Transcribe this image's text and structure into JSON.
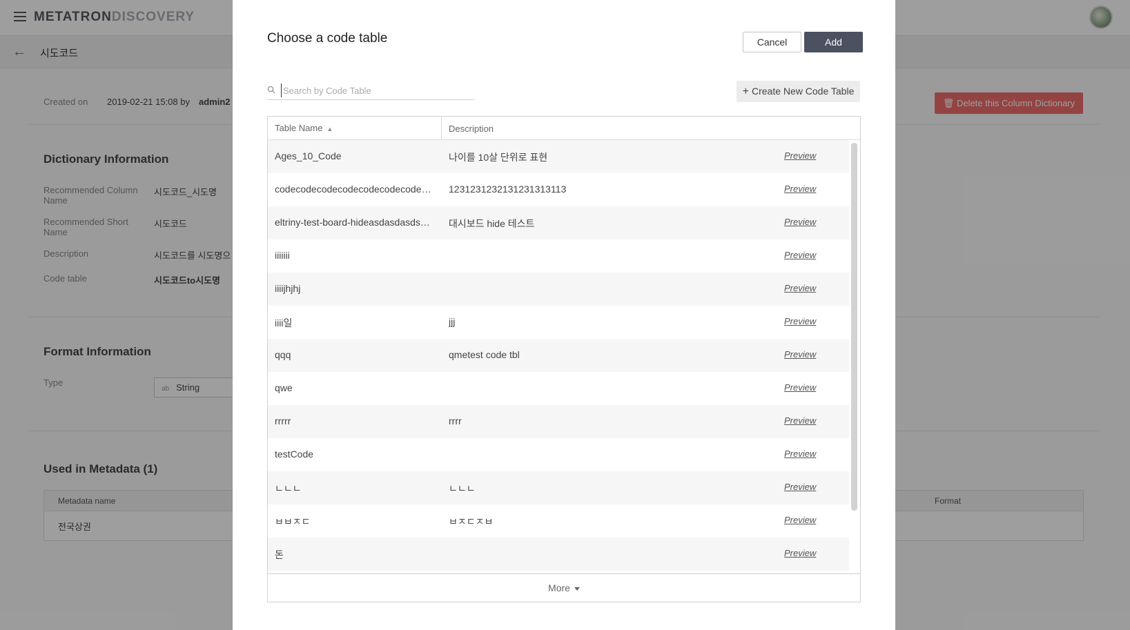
{
  "app": {
    "brand_primary": "METATRON",
    "brand_secondary": "DISCOVERY"
  },
  "page": {
    "title": "시도코드",
    "created_label": "Created on",
    "created_value": "2019-02-21 15:08 by",
    "created_user": "admin2",
    "delete_button": "Delete this Column Dictionary",
    "dictionary_section": "Dictionary Information",
    "rec_column_label": "Recommended Column Name",
    "rec_column_value": "시도코드_시도명",
    "rec_short_label": "Recommended Short Name",
    "rec_short_value": "시도코드",
    "description_label": "Description",
    "description_value": "시도코드를 시도명으",
    "code_table_label": "Code table",
    "code_table_value": "시도코드to시도명",
    "format_section": "Format Information",
    "type_label": "Type",
    "type_value": "String",
    "used_section": "Used in Metadata (1)",
    "meta_col_name": "Metadata name",
    "meta_col_format": "Format",
    "meta_row_name": "전국상권"
  },
  "modal": {
    "title": "Choose a code table",
    "cancel_label": "Cancel",
    "add_label": "Add",
    "search_placeholder": "Search by Code Table",
    "create_label": "Create New Code Table",
    "col_name": "Table Name",
    "col_desc": "Description",
    "preview_label": "Preview",
    "more_label": "More",
    "rows": [
      {
        "name": "Ages_10_Code",
        "desc": "나이를 10살 단위로 표현"
      },
      {
        "name": "codecodecodecodecodecodecodecodec…",
        "desc": "1231231232131231313113"
      },
      {
        "name": "eltriny-test-board-hideasdasdasds…",
        "desc": "대시보드 hide 테스트"
      },
      {
        "name": "iiiiiii",
        "desc": ""
      },
      {
        "name": "iiiijhjhj",
        "desc": ""
      },
      {
        "name": "iiii일",
        "desc": "jjj"
      },
      {
        "name": "qqq",
        "desc": "qmetest code tbl"
      },
      {
        "name": "qwe",
        "desc": ""
      },
      {
        "name": "rrrrr",
        "desc": "rrrr"
      },
      {
        "name": "testCode",
        "desc": ""
      },
      {
        "name": "ㄴㄴㄴ",
        "desc": "ㄴㄴㄴ"
      },
      {
        "name": "ㅂㅂㅈㄷ",
        "desc": "ㅂㅈㄷㅈㅂ"
      },
      {
        "name": "돈",
        "desc": ""
      }
    ]
  },
  "colors": {
    "primary_button": "#4b5160",
    "delete_button": "#ef6d6d"
  }
}
